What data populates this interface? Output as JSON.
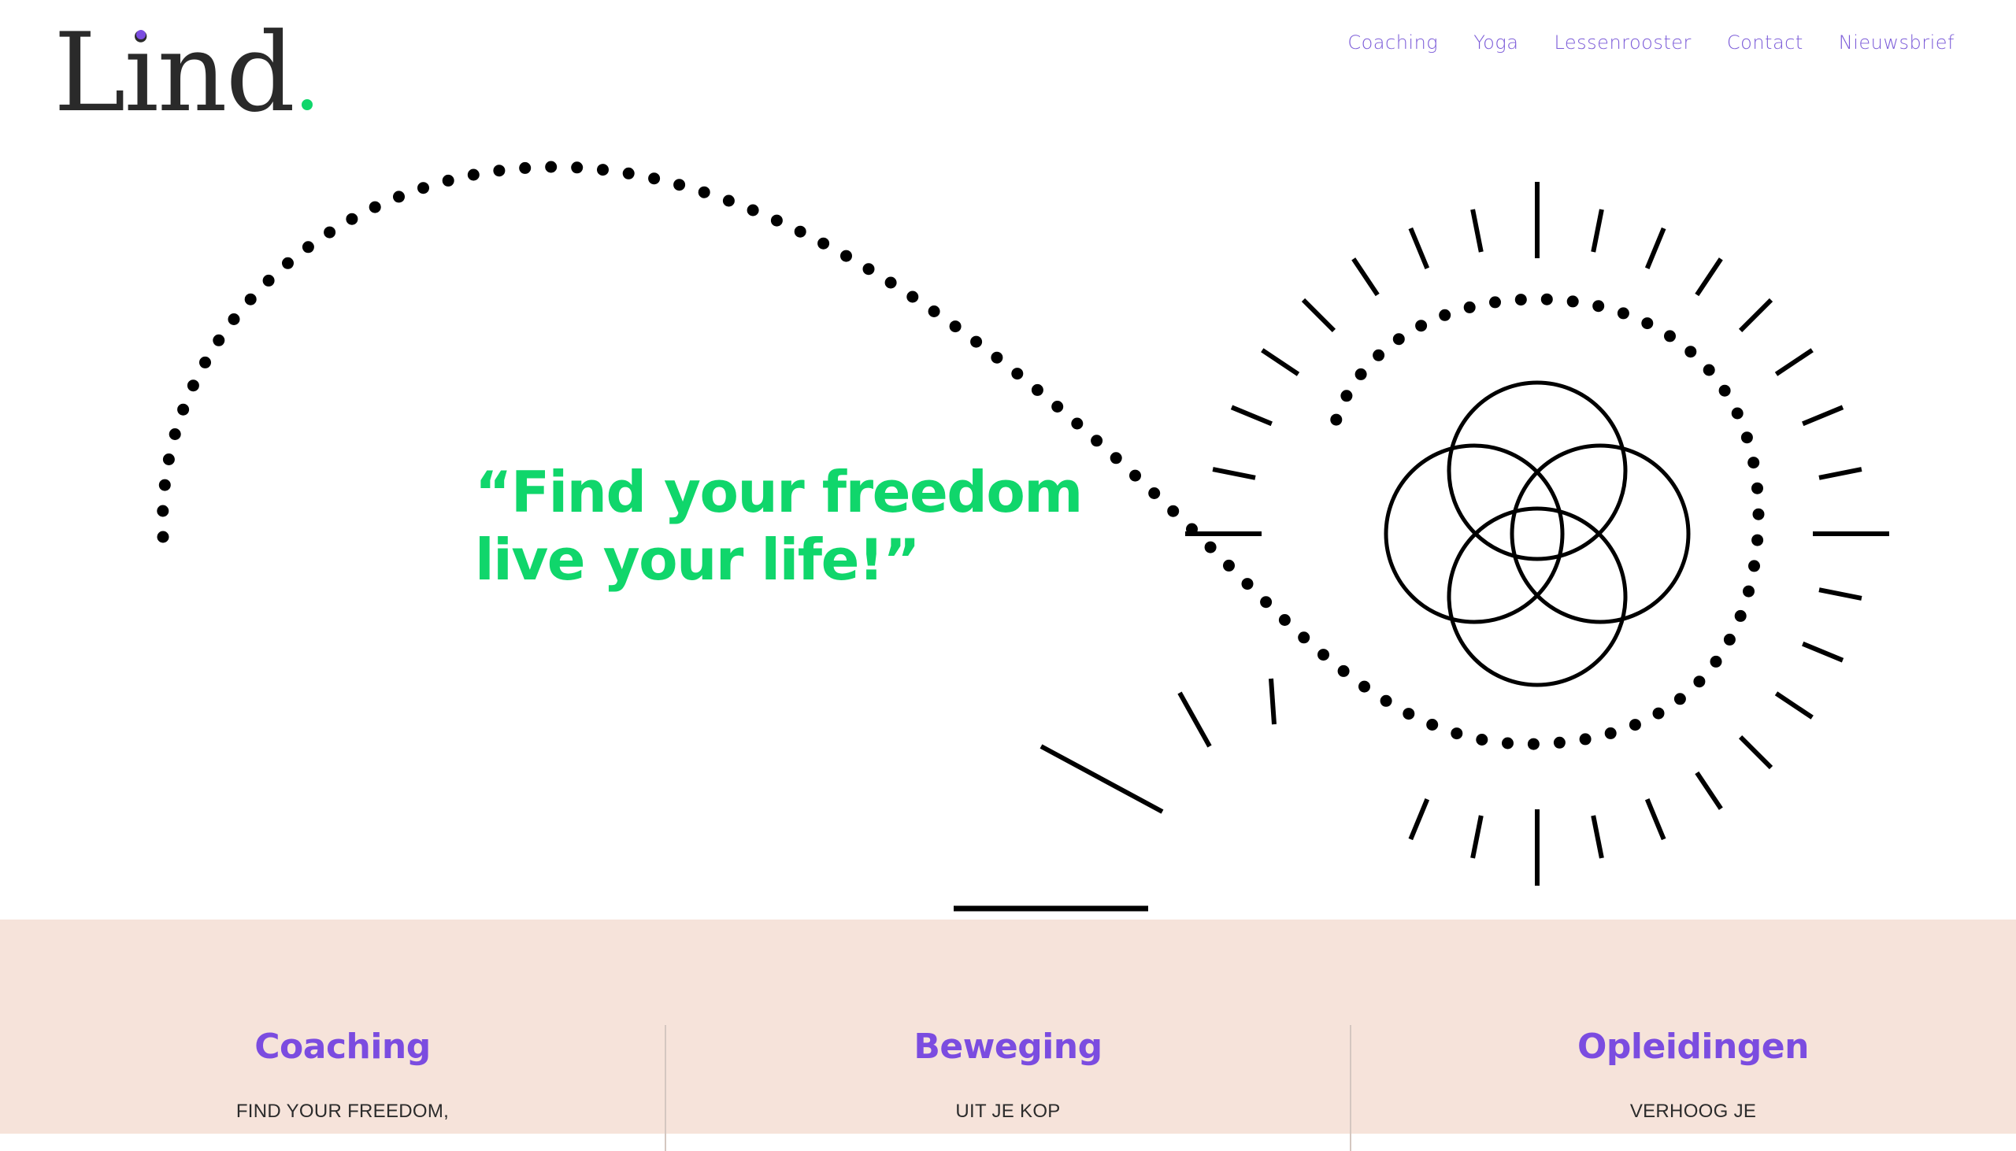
{
  "brand": {
    "name": "Lind",
    "accent_purple": "#7b4ce0",
    "accent_green": "#10d66b",
    "band_color": "#f6e3da"
  },
  "nav": {
    "items": [
      "Coaching",
      "Yoga",
      "Lessenrooster",
      "Contact",
      "Nieuwsbrief"
    ]
  },
  "hero": {
    "quote_line1": "“Find your freedom",
    "quote_line2": "live your life!”"
  },
  "sections": [
    {
      "title": "Coaching",
      "subtitle": "FIND YOUR FREEDOM,"
    },
    {
      "title": "Beweging",
      "subtitle": "UIT JE KOP"
    },
    {
      "title": "Opleidingen",
      "subtitle": "VERHOOG JE"
    }
  ]
}
